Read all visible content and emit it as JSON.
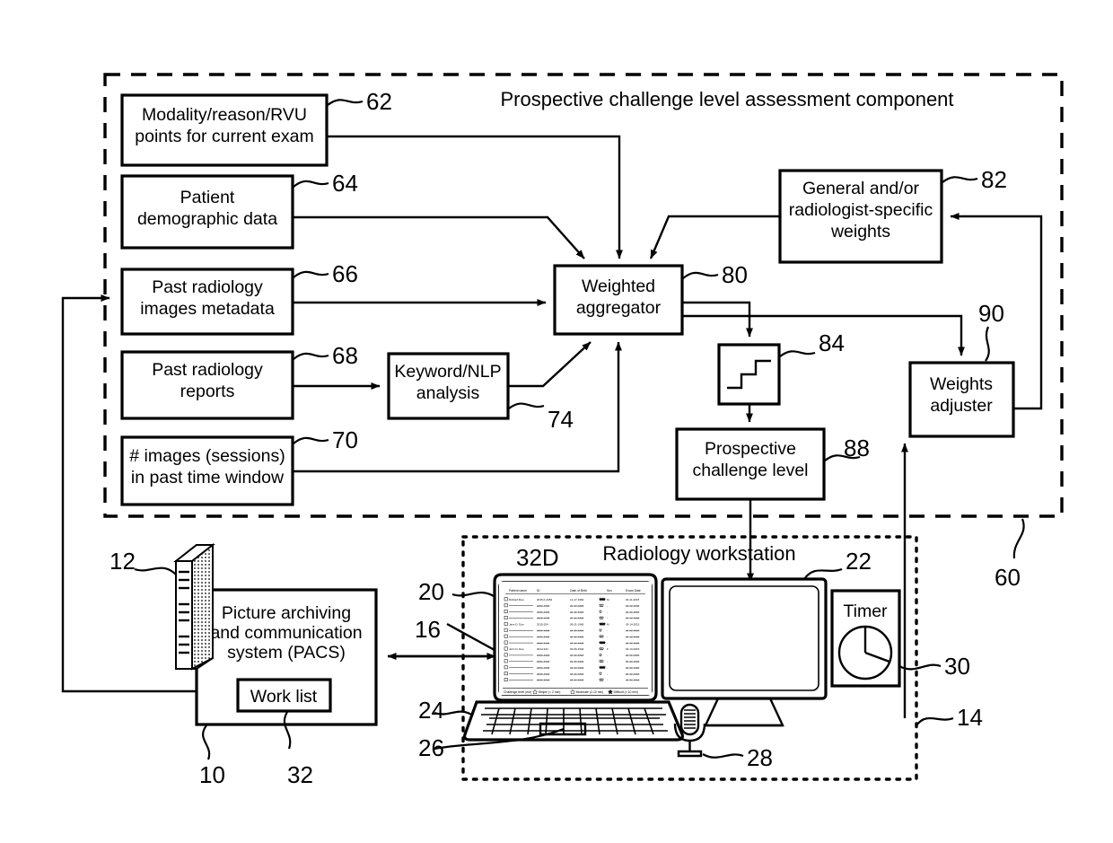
{
  "figure": {
    "title_component": "Prospective challenge level assessment component",
    "workstation_title": "Radiology workstation"
  },
  "boxes": {
    "modality": {
      "line1": "Modality/reason/RVU",
      "line2": "points for current exam",
      "ref": "62"
    },
    "patient": {
      "line1": "Patient",
      "line2": "demographic data",
      "ref": "64"
    },
    "past_images": {
      "line1": "Past radiology",
      "line2": "images metadata",
      "ref": "66"
    },
    "past_reports": {
      "line1": "Past radiology",
      "line2": "reports",
      "ref": "68"
    },
    "num_images": {
      "line1": "# images (sessions)",
      "line2": "in past time window",
      "ref": "70"
    },
    "nlp": {
      "line1": "Keyword/NLP",
      "line2": "analysis",
      "ref": "74"
    },
    "aggregator": {
      "line1": "Weighted",
      "line2": "aggregator",
      "ref": "80"
    },
    "weights": {
      "line1": "General and/or",
      "line2": "radiologist-specific",
      "line3": "weights",
      "ref": "82"
    },
    "step": {
      "ref": "84",
      "icon": "step-function-icon"
    },
    "challenge": {
      "line1": "Prospective",
      "line2": "challenge level",
      "ref": "88"
    },
    "adjuster": {
      "line1": "Weights",
      "line2": "adjuster",
      "ref": "90"
    },
    "pacs": {
      "line1": "Picture archiving",
      "line2": "and communication",
      "line3": "system (PACS)",
      "ref": "10"
    },
    "worklist": {
      "label": "Work list",
      "ref": "32"
    },
    "timer": {
      "label": "Timer",
      "ref": "30",
      "icon": "pie-clock-icon"
    }
  },
  "refs": {
    "assessment_component": "60",
    "workstation": "14",
    "server": "12",
    "laptop_screen": "20",
    "worklist_display": "32D",
    "link_arrow": "16",
    "monitor": "22",
    "keyboard": "24",
    "touchpad": "26",
    "microphone": "28"
  },
  "worklist_table": {
    "columns": [
      "Patient name",
      "ID",
      "Date of Birth",
      "Sex",
      "Exam Date"
    ],
    "rows": [
      {
        "name": "Richard Roe",
        "id": "2015-F-4452",
        "dob": "12-17-1960",
        "sex": "M",
        "exam": "03-11-2015",
        "stars": 3
      },
      {
        "name": "",
        "id": "####-####",
        "dob": "##-##-####",
        "sex": "-",
        "exam": "##-##-####",
        "stars": 2
      },
      {
        "name": "",
        "id": "####-####",
        "dob": "##-##-####",
        "sex": "-",
        "exam": "##-##-####",
        "stars": 1
      },
      {
        "name": "",
        "id": "####-####",
        "dob": "##-##-####",
        "sex": "-",
        "exam": "##-##-####",
        "stars": 2
      },
      {
        "name": "Jane D. Doe",
        "id": "2015-254",
        "dob": "09-21-1966",
        "sex": "M",
        "exam": "03-14-2015",
        "stars": 3
      },
      {
        "name": "",
        "id": "####-####",
        "dob": "##-##-####",
        "sex": "-",
        "exam": "##-##-####",
        "stars": 1
      },
      {
        "name": "",
        "id": "####-####",
        "dob": "##-##-####",
        "sex": "-",
        "exam": "##-##-####",
        "stars": 2
      },
      {
        "name": "",
        "id": "####-####",
        "dob": "##-##-####",
        "sex": "-",
        "exam": "##-##-####",
        "stars": 3
      },
      {
        "name": "John D. Doe",
        "id": "2014-344",
        "dob": "03-06-1940",
        "sex": "F",
        "exam": "03-13-2015",
        "stars": 2
      },
      {
        "name": "",
        "id": "####-####",
        "dob": "##-##-####",
        "sex": "-",
        "exam": "##-##-####",
        "stars": 1
      },
      {
        "name": "",
        "id": "####-####",
        "dob": "##-##-####",
        "sex": "-",
        "exam": "##-##-####",
        "stars": 2
      },
      {
        "name": "",
        "id": "####-####",
        "dob": "##-##-####",
        "sex": "-",
        "exam": "##-##-####",
        "stars": 3
      },
      {
        "name": "",
        "id": "####-####",
        "dob": "##-##-####",
        "sex": "-",
        "exam": "##-##-####",
        "stars": 1
      },
      {
        "name": "",
        "id": "####-####",
        "dob": "##-##-####",
        "sex": "-",
        "exam": "##-##-####",
        "stars": 2
      }
    ],
    "legend": {
      "label": "Challenge level (est)",
      "items": [
        {
          "text": "Simple (< 2 min)",
          "style": "outline-star"
        },
        {
          "text": "Moderate (2-10 min)",
          "style": "outline-star"
        },
        {
          "text": "Difficult (> 10 min)",
          "style": "filled-star"
        }
      ]
    }
  },
  "colors": {
    "ink": "#000000",
    "paper": "#ffffff"
  }
}
